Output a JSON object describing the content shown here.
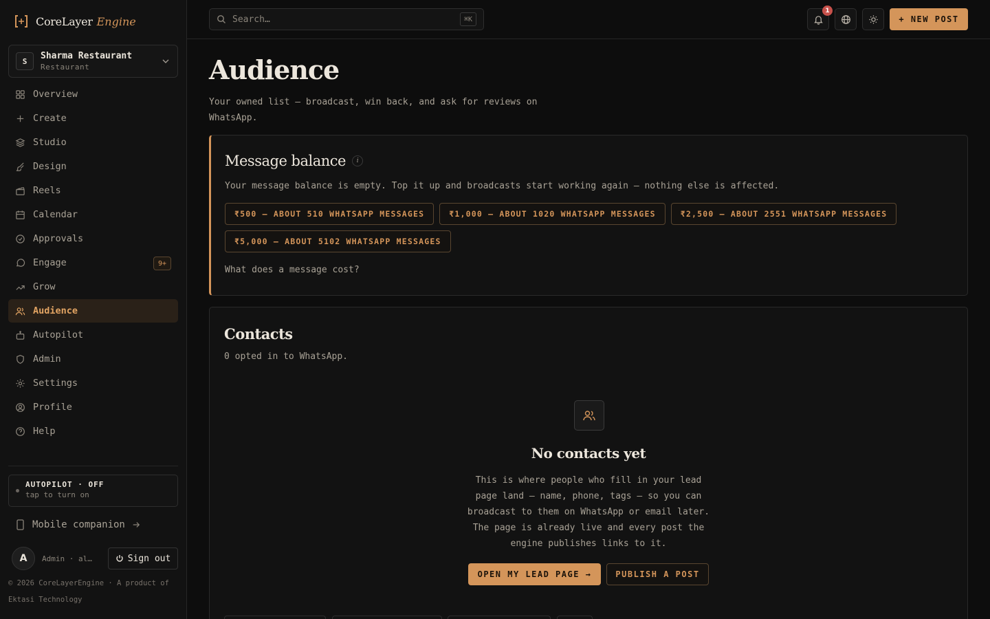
{
  "brand": {
    "name": "CoreLayer",
    "engine": "Engine"
  },
  "workspace": {
    "initial": "S",
    "name": "Sharma Restaurant",
    "type": "Restaurant"
  },
  "nav": [
    {
      "label": "Overview",
      "icon": "grid-icon"
    },
    {
      "label": "Create",
      "icon": "plus-icon"
    },
    {
      "label": "Studio",
      "icon": "layers-icon"
    },
    {
      "label": "Design",
      "icon": "brush-icon"
    },
    {
      "label": "Reels",
      "icon": "clapper-icon"
    },
    {
      "label": "Calendar",
      "icon": "calendar-icon"
    },
    {
      "label": "Approvals",
      "icon": "check-circle-icon"
    },
    {
      "label": "Engage",
      "icon": "chat-icon",
      "badge": "9+"
    },
    {
      "label": "Grow",
      "icon": "trend-up-icon"
    },
    {
      "label": "Audience",
      "icon": "users-icon",
      "active": true
    },
    {
      "label": "Autopilot",
      "icon": "bot-icon"
    },
    {
      "label": "Admin",
      "icon": "shield-icon"
    },
    {
      "label": "Settings",
      "icon": "gear-icon"
    },
    {
      "label": "Profile",
      "icon": "user-circle-icon"
    },
    {
      "label": "Help",
      "icon": "help-circle-icon"
    }
  ],
  "autopilot": {
    "title": "AUTOPILOT · OFF",
    "sub": "tap to turn on"
  },
  "mobile": {
    "label": "Mobile companion"
  },
  "user": {
    "initial": "A",
    "name": "Admin · al…",
    "signout": "Sign out"
  },
  "footer": {
    "text": "© 2026 CoreLayerEngine · A product of Ektasi Technology"
  },
  "topbar": {
    "search_placeholder": "Search…",
    "search_kbd": "⌘K",
    "notif_count": "1",
    "new_post": "+ NEW POST"
  },
  "page": {
    "title": "Audience",
    "subtitle": "Your owned list — broadcast, win back, and ask for reviews on WhatsApp."
  },
  "balance": {
    "title": "Message balance",
    "info": "i",
    "text": "Your message balance is empty. Top it up and broadcasts start working again — nothing else is affected.",
    "topups": [
      "₹500 — ABOUT 510 WHATSAPP MESSAGES",
      "₹1,000 — ABOUT 1020 WHATSAPP MESSAGES",
      "₹2,500 — ABOUT 2551 WHATSAPP MESSAGES",
      "₹5,000 — ABOUT 5102 WHATSAPP MESSAGES"
    ],
    "cost_link": "What does a message cost?"
  },
  "contacts": {
    "title": "Contacts",
    "sub": "0 opted in to WhatsApp.",
    "empty_title": "No contacts yet",
    "empty_desc": "This is where people who fill in your lead page land — name, phone, tags — so you can broadcast to them on WhatsApp or email later. The page is already live and every post the engine publishes links to it.",
    "btn_lead": "OPEN MY LEAD PAGE →",
    "btn_publish": "PUBLISH A POST"
  },
  "colors": {
    "accent": "#d4955a",
    "bg": "#0d0d0d",
    "panel": "#121212",
    "notif": "#c7514b"
  }
}
